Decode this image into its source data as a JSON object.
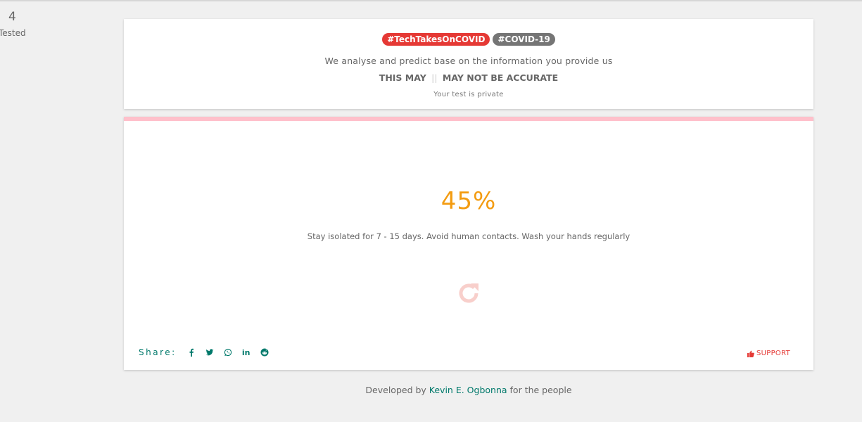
{
  "stat": {
    "count": "4",
    "label": "Tested"
  },
  "header": {
    "tags": [
      "#TechTakesOnCOVID",
      "#COVID-19"
    ],
    "description": "We analyse and predict base on the information you provide us",
    "warning_left": "THIS MAY",
    "warning_sep": "||",
    "warning_right": "MAY NOT BE ACCURATE",
    "privacy": "Your test is private"
  },
  "result": {
    "percent": "45%",
    "advice": "Stay isolated for 7 - 15 days. Avoid human contacts. Wash your hands regularly",
    "risk_level": 0.45,
    "bar_color": "#ffc0cb",
    "percent_color": "#f39c12"
  },
  "share": {
    "label": "Share:",
    "icons": [
      "facebook-icon",
      "twitter-icon",
      "whatsapp-icon",
      "linkedin-icon",
      "reddit-icon"
    ],
    "linkedin_text": "in"
  },
  "support": {
    "label": "SUPPORT",
    "icon": "thumbs-up-icon"
  },
  "footer": {
    "prefix": "Developed by",
    "author": "Kevin E. Ogbonna",
    "suffix": "for the people"
  },
  "colors": {
    "accent_red": "#e53935",
    "tag_grey": "#757575",
    "teal": "#00796b",
    "refresh": "#f8cfcb"
  }
}
